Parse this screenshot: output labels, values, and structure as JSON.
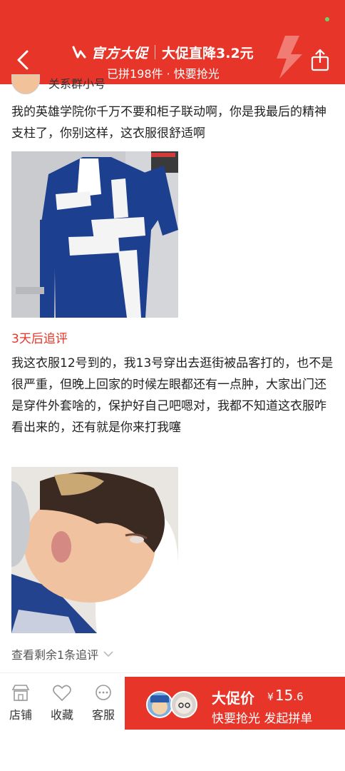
{
  "header": {
    "brand": "官方大促",
    "deal": "大促直降3.2元",
    "sub": "已拼198件 · 快要抢光",
    "accent_color": "#e8352a"
  },
  "review": {
    "reviewer_name": "关系群小号",
    "text1": "我的英雄学院你千万不要和柜子联动啊，你是我最后的精神支柱了，你别这样，这衣服很舒适啊",
    "followup_label": "3天后追评",
    "text2": "我这衣服12号到的，我13号穿出去逛街被品客打的，也不是很严重，但晚上回家的时候左眼都还有一点肿，大家出门还是穿件外套啥的，保护好自己吧嗯对，我都不知道这衣服咋看出来的，还有就是你来打我噻",
    "more_followups": "查看剩余1条追评"
  },
  "bottom_bar": {
    "tabs": [
      {
        "label": "店铺",
        "icon": "store-icon"
      },
      {
        "label": "收藏",
        "icon": "heart-icon"
      },
      {
        "label": "客服",
        "icon": "chat-icon"
      }
    ],
    "buy_title": "大促价",
    "currency": "¥",
    "price_int": "15",
    "price_dec": ".6",
    "buy_sub": "快要抢光 发起拼单"
  }
}
